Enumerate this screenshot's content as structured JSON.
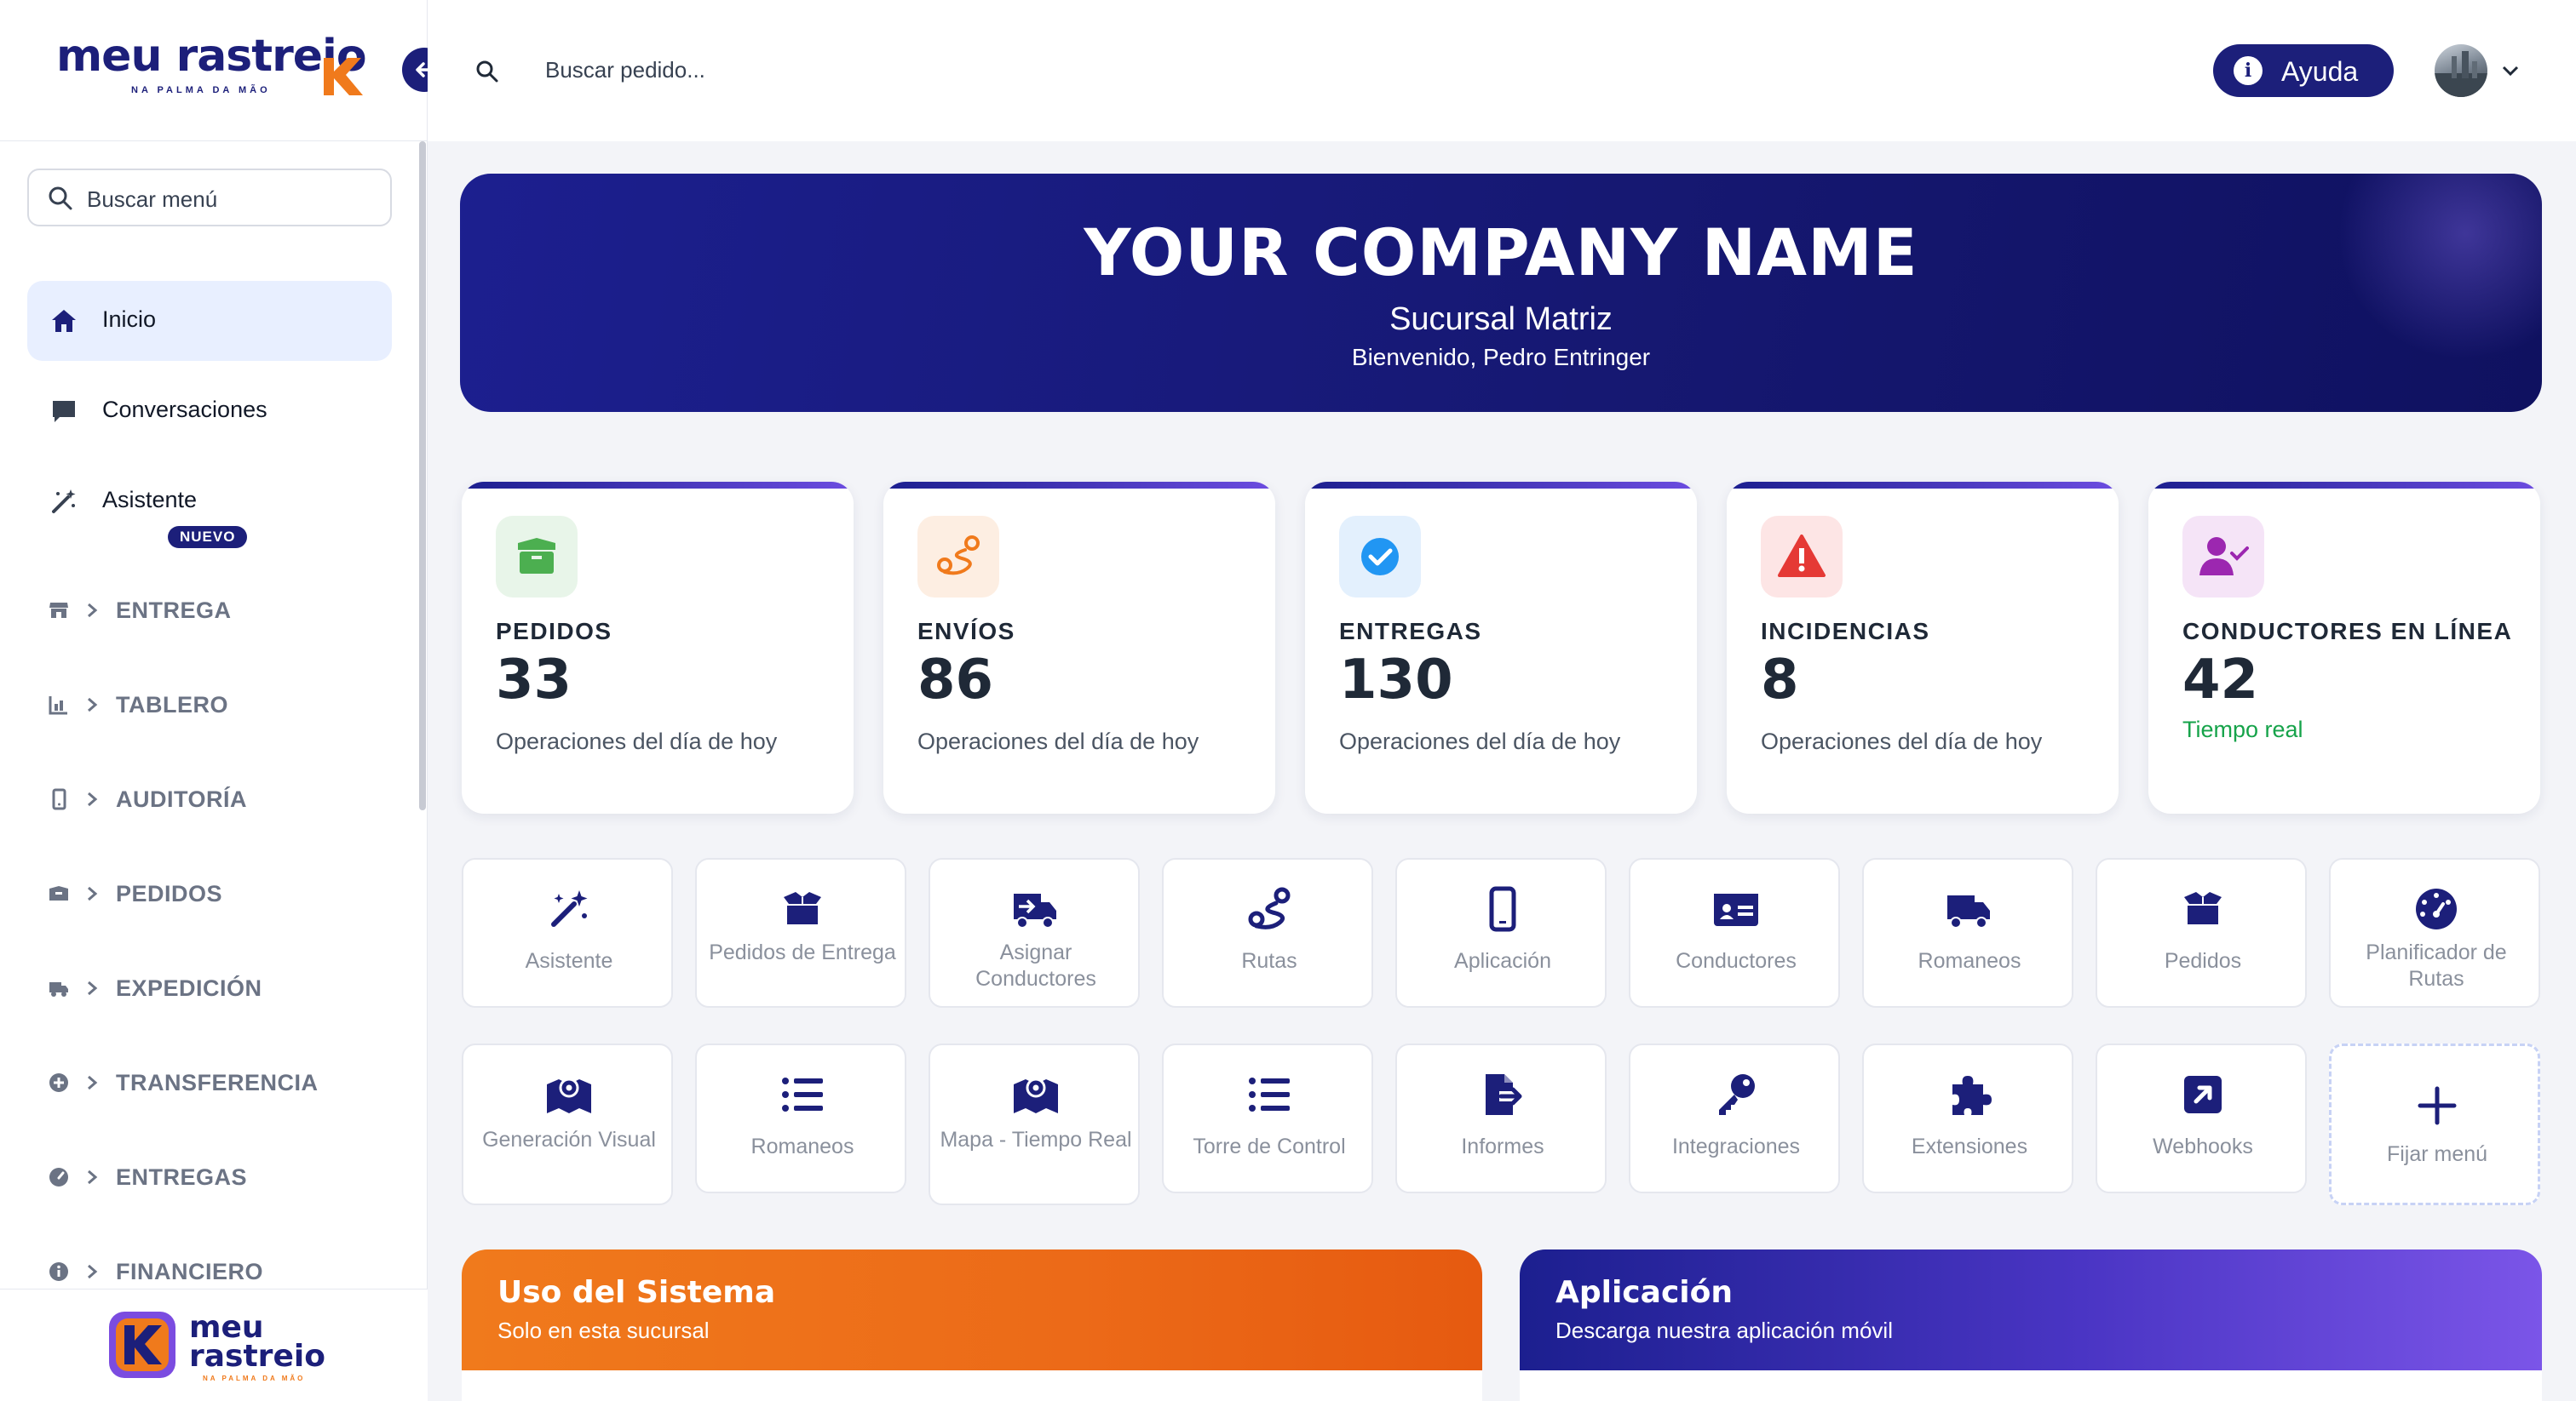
{
  "brand": {
    "word": "meu rastreio",
    "tagline": "NA PALMA DA MÃO",
    "footer_word_1": "meu",
    "footer_word_2": "rastreio",
    "footer_tagline": "NA PALMA DA MÃO",
    "primary": "#1c1f7a",
    "accent": "#f07a1c"
  },
  "sidebar": {
    "search_placeholder": "Buscar menú",
    "top_items": [
      {
        "label": "Inicio",
        "icon": "home-icon",
        "active": true
      },
      {
        "label": "Conversaciones",
        "icon": "chat-icon"
      },
      {
        "label": "Asistente",
        "icon": "magic-wand-icon",
        "badge": "NUEVO"
      }
    ],
    "sections": [
      {
        "label": "ENTREGA",
        "icon": "store-icon"
      },
      {
        "label": "TABLERO",
        "icon": "chart-icon"
      },
      {
        "label": "AUDITORÍA",
        "icon": "mobile-icon"
      },
      {
        "label": "PEDIDOS",
        "icon": "box-icon"
      },
      {
        "label": "EXPEDICIÓN",
        "icon": "truck-icon"
      },
      {
        "label": "TRANSFERENCIA",
        "icon": "plus-circle-icon"
      },
      {
        "label": "ENTREGAS",
        "icon": "gauge-icon"
      },
      {
        "label": "FINANCIERO",
        "icon": "info-icon"
      }
    ]
  },
  "header": {
    "search_placeholder": "Buscar pedido...",
    "help_label": "Ayuda"
  },
  "hero": {
    "title": "YOUR COMPANY NAME",
    "subtitle": "Sucursal Matriz",
    "welcome": "Bienvenido, Pedro Entringer"
  },
  "stats": [
    {
      "label": "PEDIDOS",
      "value": "33",
      "caption": "Operaciones del día de hoy",
      "icon": "box-icon",
      "color": "#4caf50"
    },
    {
      "label": "ENVÍOS",
      "value": "86",
      "caption": "Operaciones del día de hoy",
      "icon": "route-icon",
      "color": "#f07a1c"
    },
    {
      "label": "ENTREGAS",
      "value": "130",
      "caption": "Operaciones del día de hoy",
      "icon": "check-circle-icon",
      "color": "#2196f3"
    },
    {
      "label": "INCIDENCIAS",
      "value": "8",
      "caption": "Operaciones del día de hoy",
      "icon": "warning-icon",
      "color": "#e53935"
    },
    {
      "label": "CONDUCTORES EN LÍNEA",
      "value": "42",
      "caption": "Tiempo real",
      "icon": "user-check-icon",
      "color": "#9c27b0"
    }
  ],
  "shortcuts_row1": [
    {
      "label": "Asistente",
      "icon": "magic-wand-icon"
    },
    {
      "label": "Pedidos de Entrega",
      "icon": "open-box-icon"
    },
    {
      "label": "Asignar Conductores",
      "icon": "truck-arrow-icon"
    },
    {
      "label": "Rutas",
      "icon": "route-icon"
    },
    {
      "label": "Aplicación",
      "icon": "mobile-icon"
    },
    {
      "label": "Conductores",
      "icon": "id-card-icon"
    },
    {
      "label": "Romaneos",
      "icon": "truck-icon"
    },
    {
      "label": "Pedidos",
      "icon": "open-box-icon"
    },
    {
      "label": "Planificador de Rutas",
      "icon": "gauge-icon"
    }
  ],
  "shortcuts_row2": [
    {
      "label": "Generación Visual",
      "icon": "map-icon"
    },
    {
      "label": "Romaneos",
      "icon": "list-icon"
    },
    {
      "label": "Mapa - Tiempo Real",
      "icon": "map-icon"
    },
    {
      "label": "Torre de Control",
      "icon": "list-icon"
    },
    {
      "label": "Informes",
      "icon": "file-export-icon"
    },
    {
      "label": "Integraciones",
      "icon": "key-icon"
    },
    {
      "label": "Extensiones",
      "icon": "puzzle-icon"
    },
    {
      "label": "Webhooks",
      "icon": "external-link-icon"
    },
    {
      "label": "Fijar menú",
      "icon": "plus-icon"
    }
  ],
  "panels": [
    {
      "title": "Uso del Sistema",
      "subtitle": "Solo en esta sucursal"
    },
    {
      "title": "Aplicación",
      "subtitle": "Descarga nuestra aplicación móvil"
    }
  ]
}
